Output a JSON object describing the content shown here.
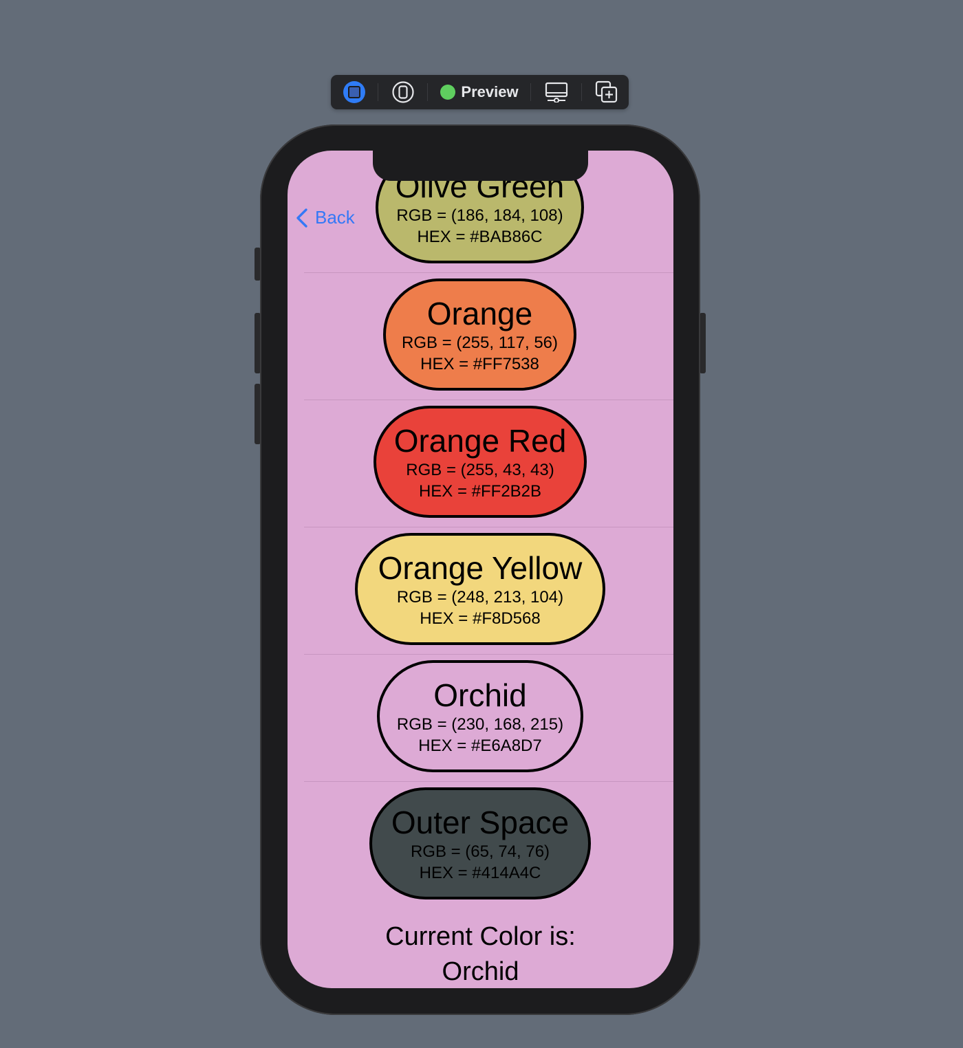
{
  "toolbar": {
    "preview_label": "Preview"
  },
  "nav": {
    "back_label": "Back"
  },
  "colors": [
    {
      "name": "Olive Green",
      "rgb": "RGB = (186, 184, 108)",
      "hex": "HEX = #BAB86C",
      "fill": "#BAB86C"
    },
    {
      "name": "Orange",
      "rgb": "RGB = (255, 117, 56)",
      "hex": "HEX = #FF7538",
      "fill": "#EE7D4B"
    },
    {
      "name": "Orange Red",
      "rgb": "RGB = (255, 43, 43)",
      "hex": "HEX = #FF2B2B",
      "fill": "#E9423A"
    },
    {
      "name": "Orange Yellow",
      "rgb": "RGB = (248, 213, 104)",
      "hex": "HEX = #F8D568",
      "fill": "#F2D77D"
    },
    {
      "name": "Orchid",
      "rgb": "RGB = (230, 168, 215)",
      "hex": "HEX = #E6A8D7",
      "fill": "#DDAAD5"
    },
    {
      "name": "Outer Space",
      "rgb": "RGB = (65, 74, 76)",
      "hex": "HEX = #414A4C",
      "fill": "#414A4C"
    }
  ],
  "current": {
    "label": "Current Color is:",
    "value": "Orchid"
  },
  "theme": {
    "background": "#DDAAD5",
    "accent": "#3478F6"
  }
}
